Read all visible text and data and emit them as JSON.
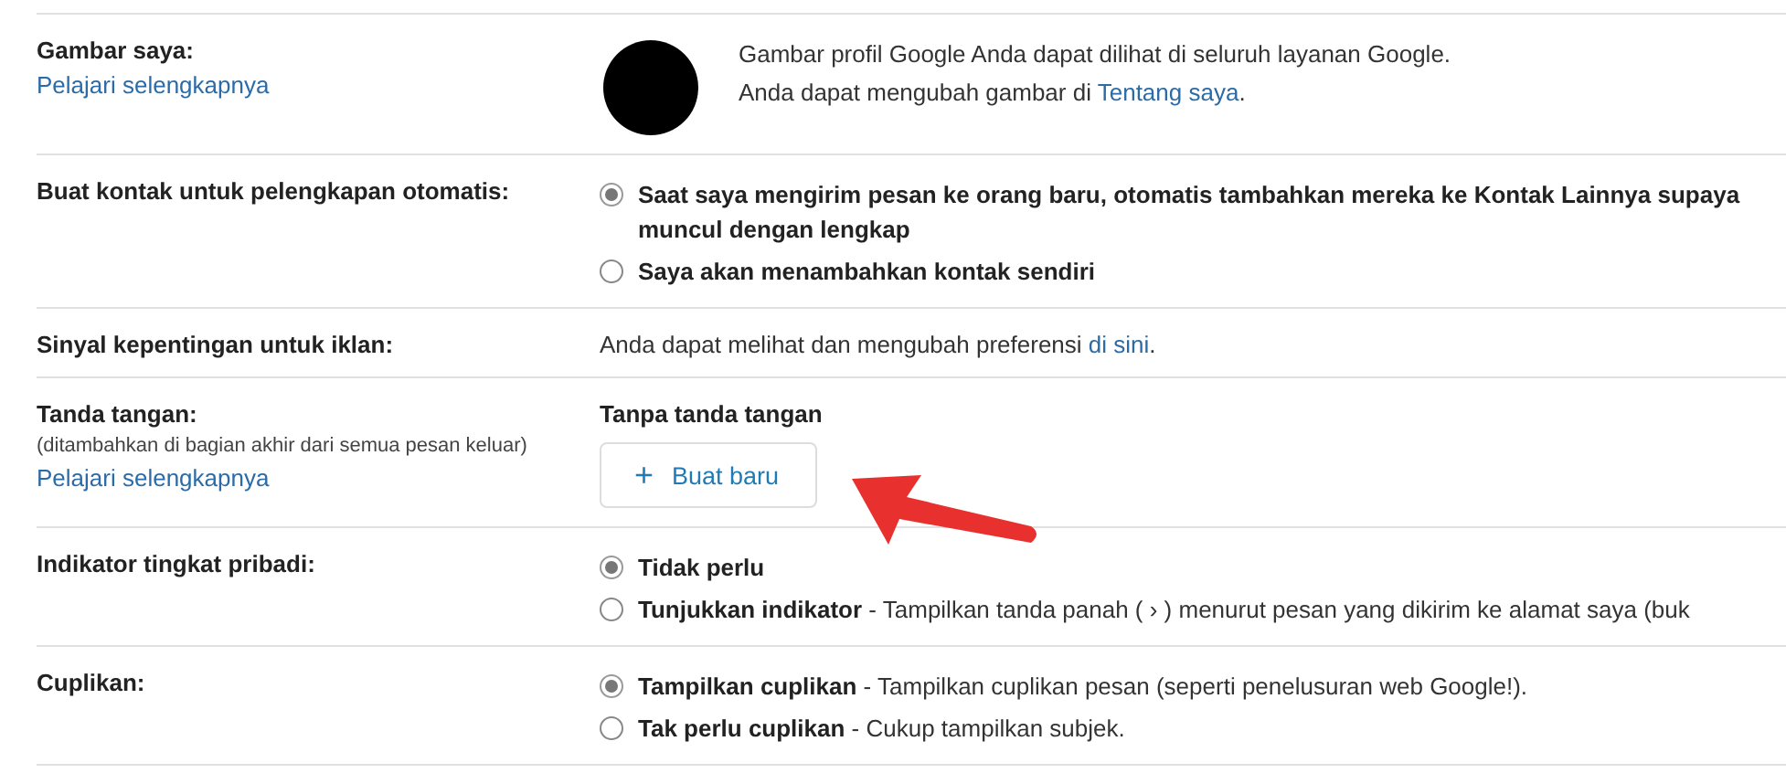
{
  "rows": [
    {
      "kind": "avatar",
      "label": "Gambar saya:",
      "link": "Pelajari selengkapnya",
      "line1": "Gambar profil Google Anda dapat dilihat di seluruh layanan Google.",
      "line2": "Anda dapat mengubah gambar di ",
      "line2_link": "Tentang saya",
      "line2_after": "."
    },
    {
      "kind": "radio",
      "label": "Buat kontak untuk pelengkapan otomatis:",
      "options": [
        {
          "label": "Saat saya mengirim pesan ke orang baru, otomatis tambahkan mereka ke Kontak Lainnya supaya",
          "label_cont": "muncul dengan lengkap",
          "selected": true
        },
        {
          "label": "Saya akan menambahkan kontak sendiri",
          "selected": false
        }
      ]
    },
    {
      "kind": "info",
      "label": "Sinyal kepentingan untuk iklan:",
      "text": "Anda dapat melihat dan mengubah preferensi ",
      "text_link": "di sini",
      "text_after": "."
    },
    {
      "kind": "signature",
      "label": "Tanda tangan:",
      "sublabel": "(ditambahkan di bagian akhir dari semua pesan keluar)",
      "link": "Pelajari selengkapnya",
      "status": "Tanpa tanda tangan",
      "button_icon": "+",
      "button": "Buat baru"
    },
    {
      "kind": "radio",
      "label": "Indikator tingkat pribadi:",
      "options": [
        {
          "label": "Tidak perlu",
          "selected": true
        },
        {
          "label": "Tunjukkan indikator",
          "desc": "- Tampilkan tanda panah ( › ) menurut pesan yang dikirim ke alamat saya (buk",
          "selected": false
        }
      ]
    },
    {
      "kind": "radio",
      "label": "Cuplikan:",
      "options": [
        {
          "label": "Tampilkan cuplikan",
          "desc": "- Tampilkan cuplikan pesan (seperti penelusuran web Google!).",
          "selected": true
        },
        {
          "label": "Tak perlu cuplikan",
          "desc": "- Cukup tampilkan subjek.",
          "selected": false
        }
      ]
    }
  ]
}
